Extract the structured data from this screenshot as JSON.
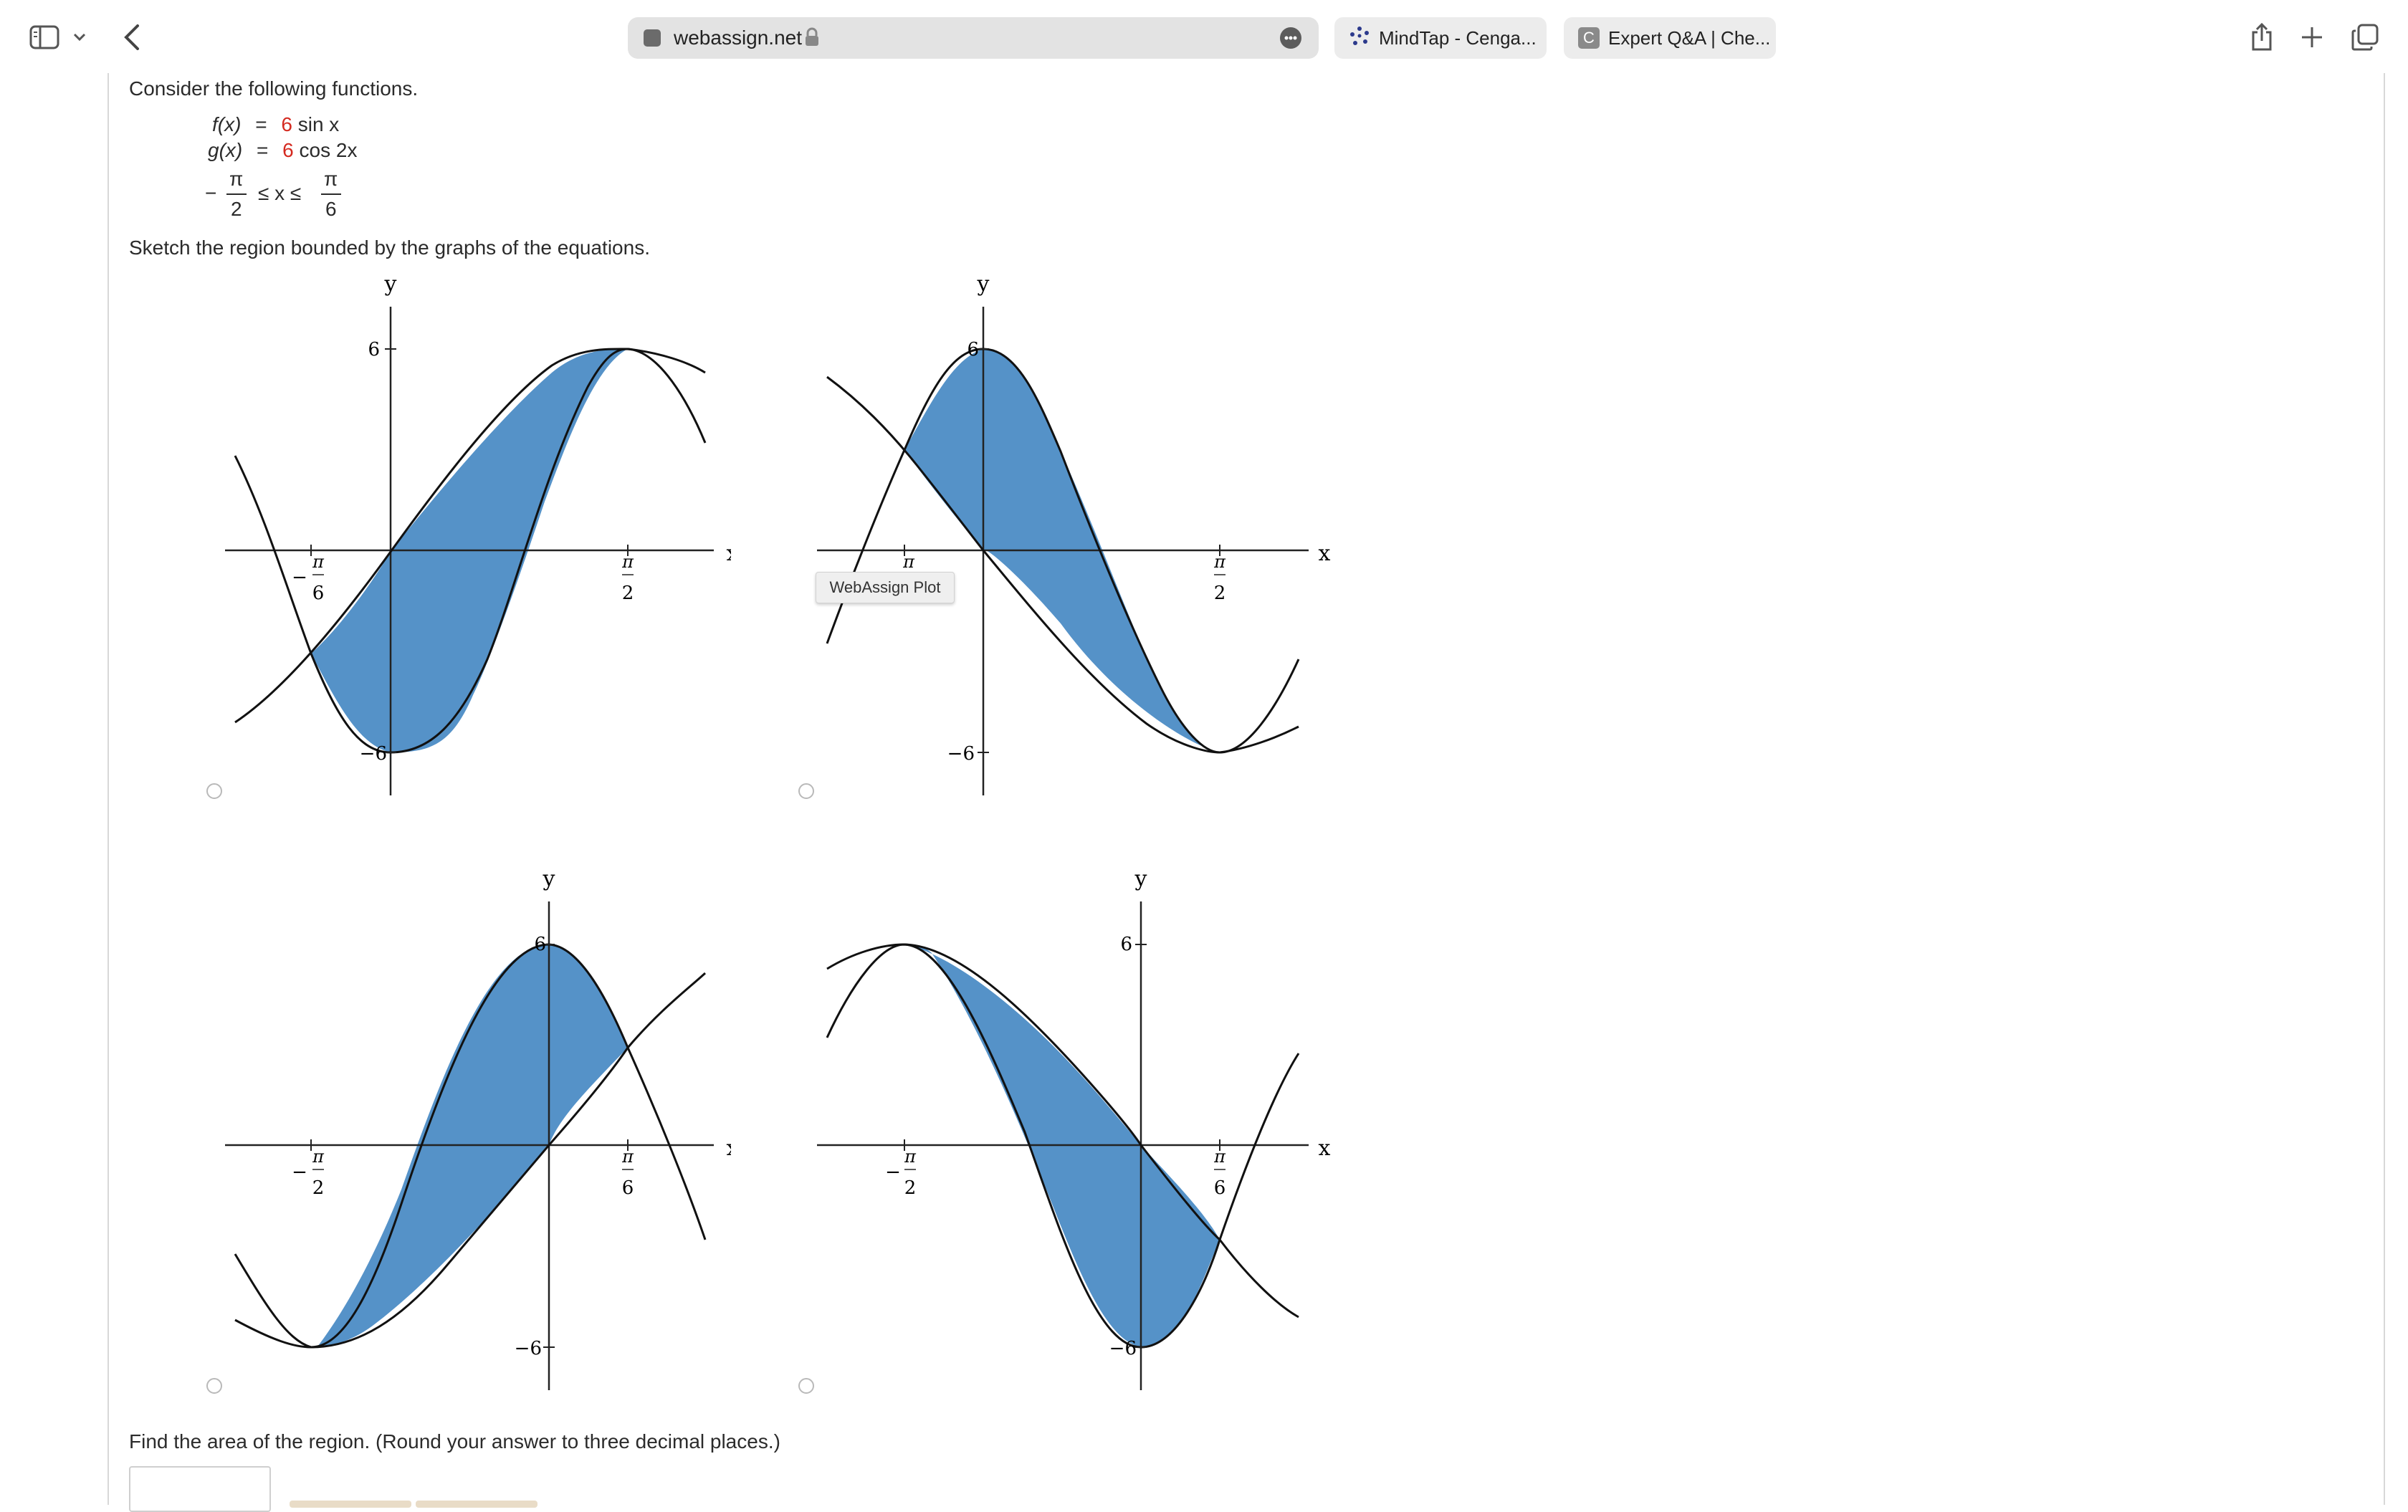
{
  "browser": {
    "address": "webassign.net",
    "tabs": [
      {
        "label": "MindTap - Cenga..."
      },
      {
        "label": "Expert Q&A | Che..."
      }
    ],
    "tab_icon_letter": "C"
  },
  "problem": {
    "intro": "Consider the following functions.",
    "f_lhs": "f(x)",
    "f_eq": "=",
    "f_coef": "6",
    "f_rhs": "sin x",
    "g_lhs": "g(x)",
    "g_eq": "=",
    "g_coef": "6",
    "g_rhs": "cos 2x",
    "interval": {
      "minus": "−",
      "lower_num": "π",
      "lower_den": "2",
      "rel": "≤ x ≤",
      "upper_num": "π",
      "upper_den": "6"
    },
    "sketch_prompt": "Sketch the region bounded by the graphs of the equations.",
    "area_prompt": "Find the area of the region. (Round your answer to three decimal places.)"
  },
  "plots": [
    {
      "ylabel": "y",
      "xlabel": "x",
      "tick_left_sign": "−",
      "tick_left_num": "π",
      "tick_left_den": "6",
      "tick_right_num": "π",
      "tick_right_den": "2",
      "ytick_top": "6",
      "ytick_bottom": "−6"
    },
    {
      "ylabel": "y",
      "xlabel": "x",
      "tick_left_num": "π",
      "tick_right_num": "π",
      "tick_right_den": "2",
      "ytick_top": "6",
      "ytick_bottom": "−6"
    },
    {
      "ylabel": "y",
      "xlabel": "x",
      "tick_left_sign": "−",
      "tick_left_num": "π",
      "tick_left_den": "2",
      "tick_right_num": "π",
      "tick_right_den": "6",
      "ytick_top": "6",
      "ytick_bottom": "−6"
    },
    {
      "ylabel": "y",
      "xlabel": "x",
      "tick_left_sign": "−",
      "tick_left_num": "π",
      "tick_left_den": "2",
      "tick_right_num": "π",
      "tick_right_den": "6",
      "ytick_top": "6",
      "ytick_bottom": "−6"
    }
  ],
  "tooltip": "WebAssign Plot",
  "colors": {
    "fill": "#5592c8",
    "coef": "#d42a20"
  }
}
